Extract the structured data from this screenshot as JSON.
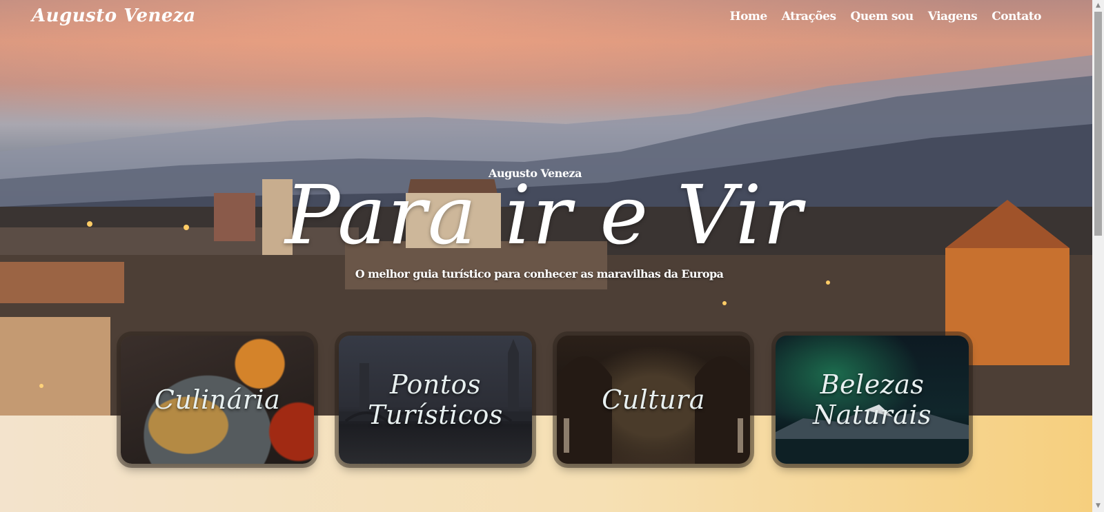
{
  "brand": "Augusto Veneza",
  "nav": {
    "items": [
      {
        "label": "Home"
      },
      {
        "label": "Atrações"
      },
      {
        "label": "Quem sou"
      },
      {
        "label": "Viagens"
      },
      {
        "label": "Contato"
      }
    ]
  },
  "hero": {
    "kicker": "Augusto Veneza",
    "headline": "Para ir e Vir",
    "tagline": "O melhor guia turístico para conhecer as maravilhas da Europa"
  },
  "cards": [
    {
      "label": "Culinária"
    },
    {
      "label": "Pontos Turísticos"
    },
    {
      "label": "Cultura"
    },
    {
      "label": "Belezas Naturais"
    }
  ],
  "scrollbar": {
    "up_icon": "triangle-up",
    "down_icon": "triangle-down"
  }
}
